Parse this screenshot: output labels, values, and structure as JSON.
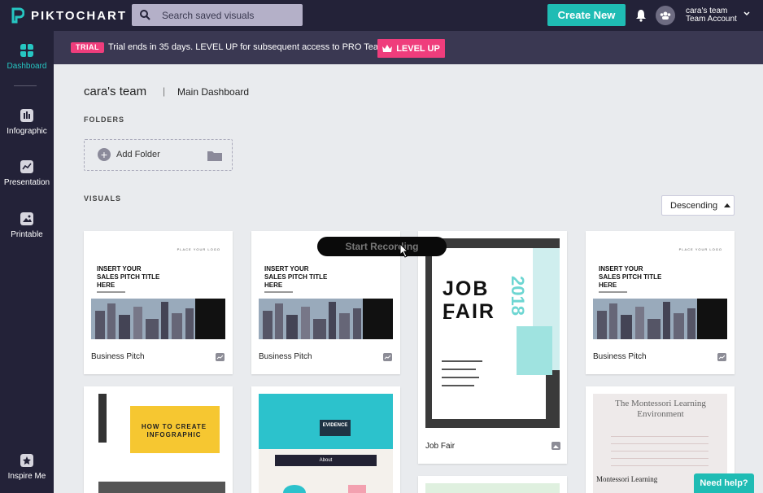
{
  "app": {
    "name": "PIKTOCHART"
  },
  "search": {
    "placeholder": "Search saved visuals"
  },
  "header": {
    "create_label": "Create New",
    "account_name": "cara's team",
    "account_type": "Team Account"
  },
  "sidebar": {
    "items": [
      {
        "label": "Dashboard",
        "icon": "grid-icon"
      },
      {
        "label": "Infographic",
        "icon": "bar-chart-icon"
      },
      {
        "label": "Presentation",
        "icon": "trend-icon"
      },
      {
        "label": "Printable",
        "icon": "image-icon"
      },
      {
        "label": "Inspire Me",
        "icon": "star-icon"
      }
    ]
  },
  "trial": {
    "badge": "TRIAL",
    "message": "Trial ends in 35 days. LEVEL UP for subsequent access to PRO Team.",
    "button": "LEVEL UP"
  },
  "breadcrumb": {
    "team": "cara's team",
    "separator": "|",
    "page": "Main Dashboard"
  },
  "folders": {
    "heading": "FOLDERS",
    "add_label": "Add Folder"
  },
  "visuals": {
    "heading": "VISUALS",
    "sort_label": "Descending",
    "cards": [
      {
        "label": "Business Pitch",
        "thumb_title": "INSERT YOUR SALES PITCH TITLE HERE"
      },
      {
        "label": "Business Pitch",
        "thumb_title": "INSERT YOUR SALES PITCH TITLE HERE"
      },
      {
        "label": "Job Fair",
        "thumb_title": "JOB FAIR",
        "year": "2018"
      },
      {
        "label": "Business Pitch",
        "thumb_title": "INSERT YOUR SALES PITCH TITLE HERE"
      },
      {
        "thumb_title": "HOW TO CREATE INFOGRAPHIC"
      },
      {
        "thumb_title": "EVIDENCE",
        "sub": "About"
      },
      {
        "thumb_title": "The Montessori Learning Environment",
        "sub": "Montessori Learning"
      }
    ]
  },
  "overlay": {
    "recording_label": "Start Recording"
  },
  "help": {
    "label": "Need help?"
  },
  "colors": {
    "teal": "#1fbcb4",
    "pink": "#ef3d7c",
    "navy": "#232238"
  }
}
